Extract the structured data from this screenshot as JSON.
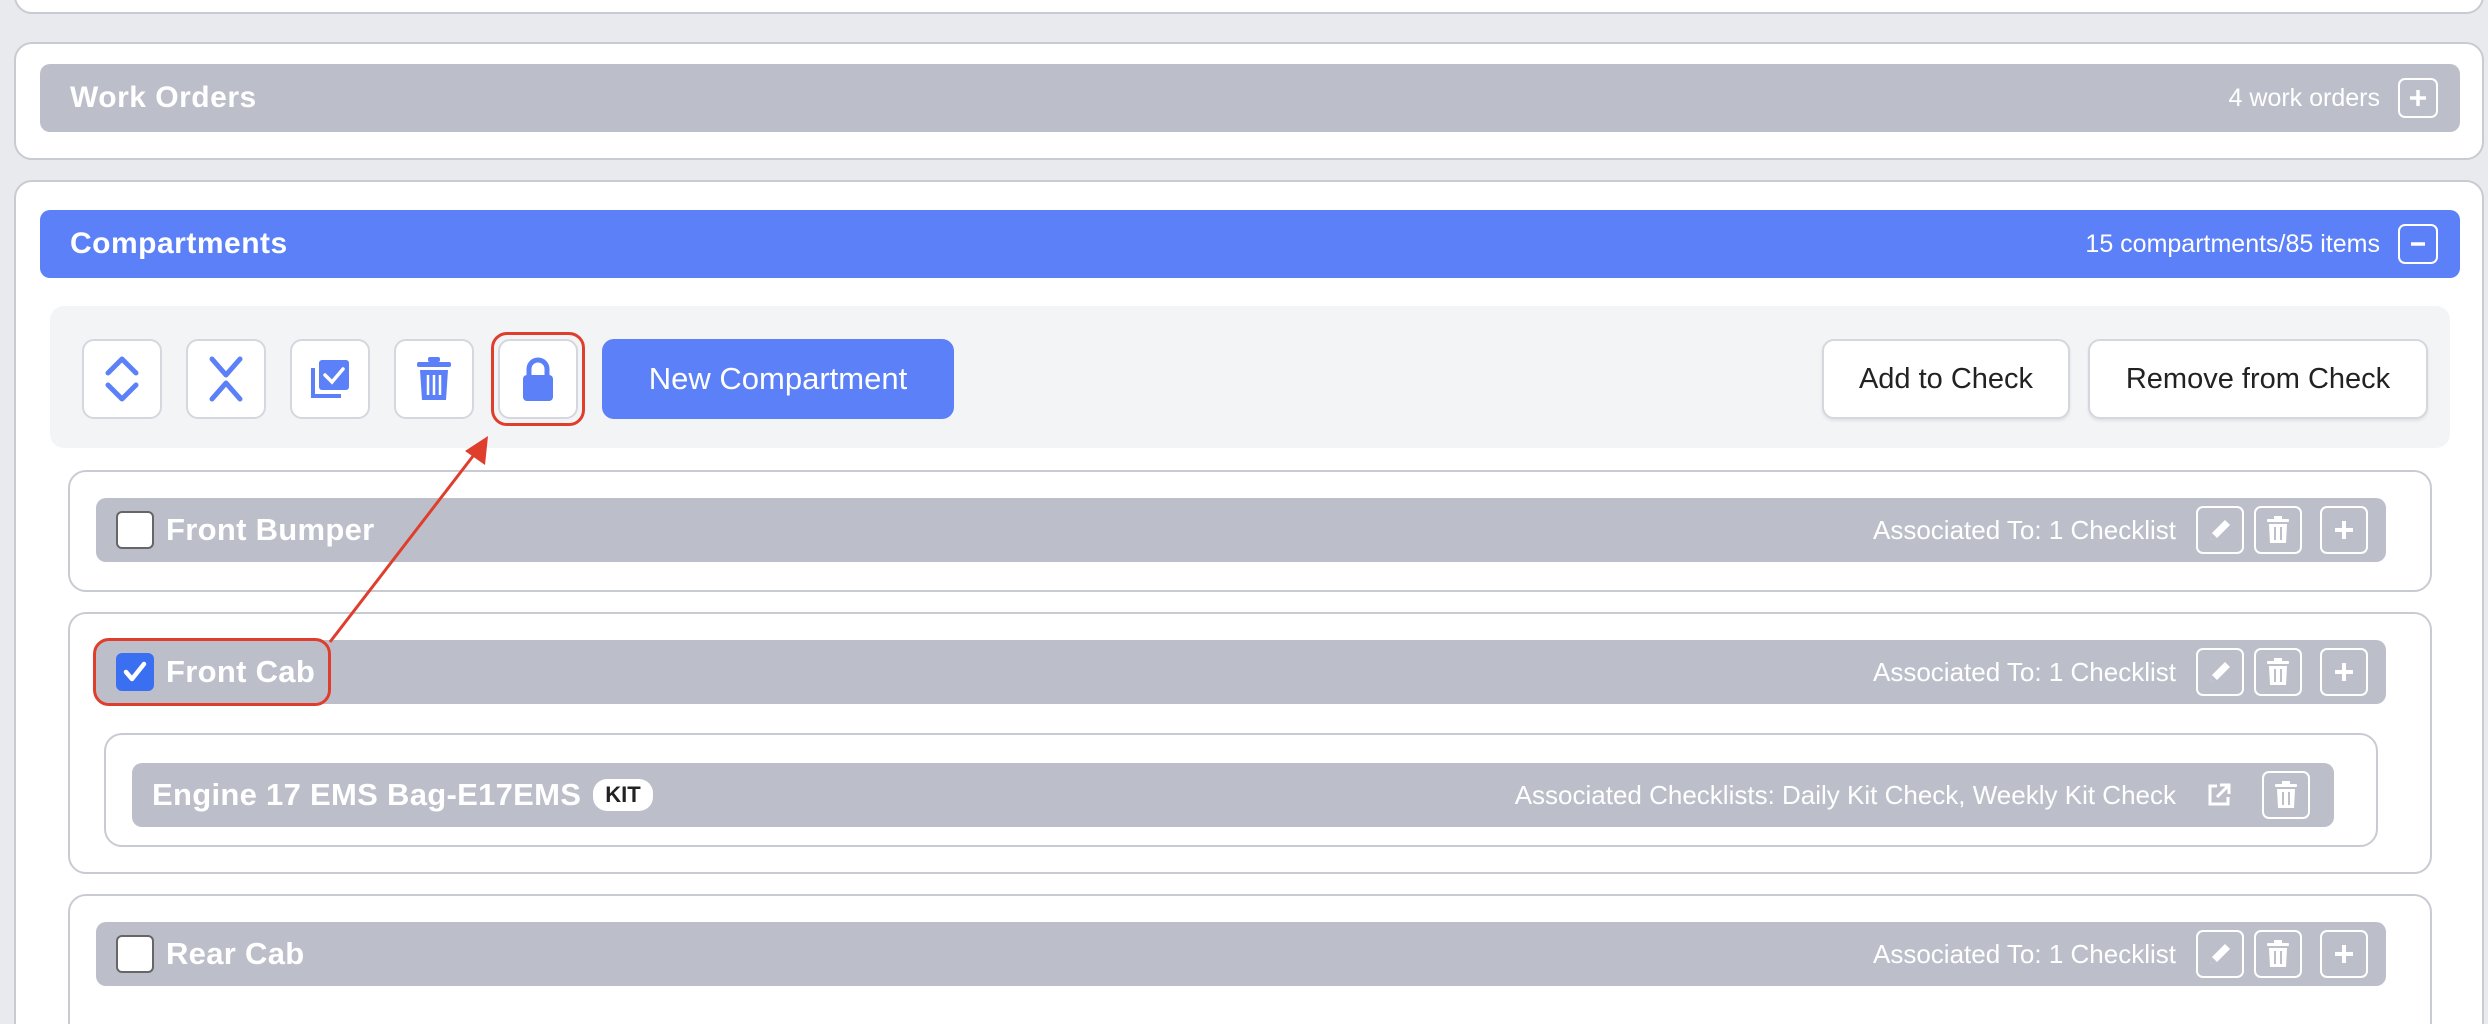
{
  "work_orders": {
    "title": "Work Orders",
    "count": "4 work orders",
    "toggle": "expand"
  },
  "compartments": {
    "title": "Compartments",
    "count": "15 compartments/85 items",
    "toggle": "collapse",
    "toolbar": {
      "tools": [
        "expand-all-icon",
        "collapse-all-icon",
        "select-all-icon",
        "trash-icon",
        "lock-icon"
      ],
      "new_label": "New Compartment",
      "add_label": "Add to Check",
      "remove_label": "Remove from Check"
    },
    "items": [
      {
        "name": "Front Bumper",
        "checked": false,
        "assoc": "Associated To: 1 Checklist"
      },
      {
        "name": "Front Cab",
        "checked": true,
        "assoc": "Associated To: 1 Checklist",
        "kits": [
          {
            "name": "Engine 17 EMS Bag-E17EMS",
            "badge": "KIT",
            "assoc": "Associated Checklists: Daily Kit Check, Weekly Kit Check"
          }
        ]
      },
      {
        "name": "Rear Cab",
        "checked": false,
        "assoc": "Associated To: 1 Checklist"
      }
    ]
  },
  "colors": {
    "accent": "#5b80f7",
    "bar_gray": "#bcbfca",
    "annotation": "#e03e2d"
  }
}
